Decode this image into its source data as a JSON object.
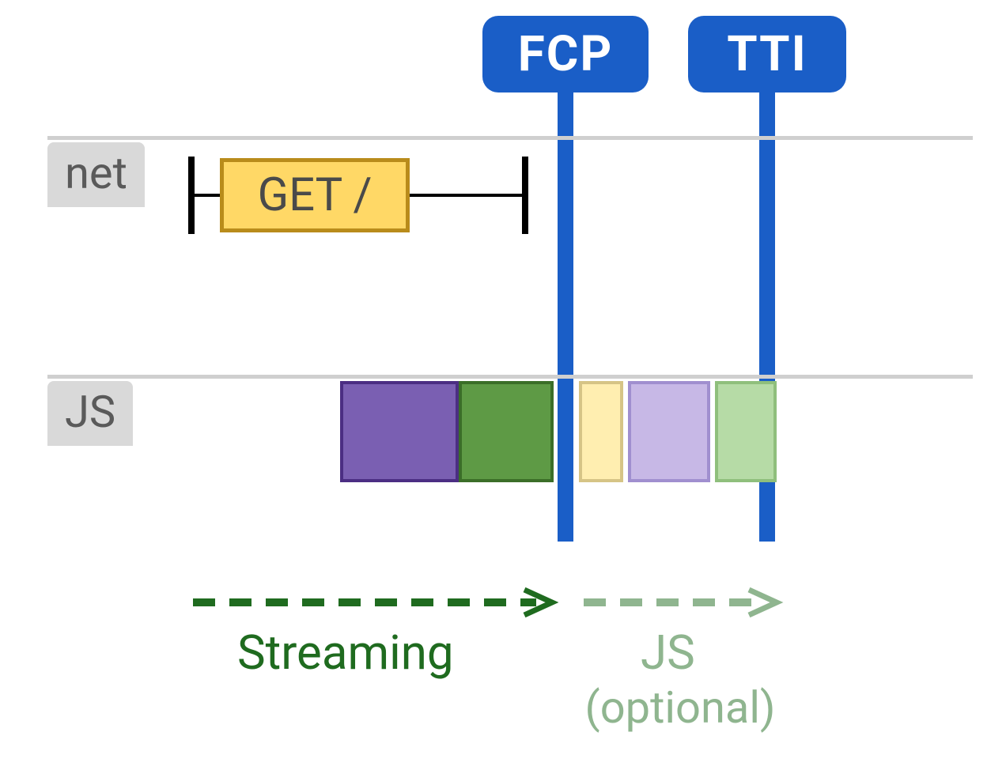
{
  "badges": {
    "fcp": "FCP",
    "tti": "TTI"
  },
  "lanes": {
    "net": "net",
    "js": "JS"
  },
  "net_request": "GET /",
  "arrows": {
    "streaming": "Streaming",
    "js_label": "JS",
    "js_optional": "(optional)"
  },
  "colors": {
    "badge": "#1a5ec7",
    "lane_line": "#cfcfcf",
    "lane_label_bg": "#d9d9d9",
    "lane_label_fg": "#5a5a5a",
    "net_box_bg": "#ffd866",
    "net_box_border": "#b98c1b",
    "purple_fill": "#7a5fb2",
    "purple_border": "#4b2e83",
    "green_fill": "#5e9a45",
    "green_border": "#3b6e28",
    "yellow_light_fill": "#ffeeb0",
    "yellow_light_border": "#d6c486",
    "purple_light_fill": "#c7b8e6",
    "purple_light_border": "#a08fcf",
    "green_light_fill": "#b6dba6",
    "green_light_border": "#8fbf7c",
    "streaming_arrow": "#1f6b1f",
    "streaming_text": "#1f6b1f",
    "js_arrow": "#8fb58f",
    "js_text": "#8fb58f"
  },
  "chart_data": {
    "type": "timeline",
    "title": "Web rendering timeline — Static SSR / Streaming",
    "timeline_range": [
      0,
      1000
    ],
    "markers": [
      {
        "name": "FCP",
        "position": 560
      },
      {
        "name": "TTI",
        "position": 828
      }
    ],
    "lanes": [
      {
        "name": "net",
        "items": [
          {
            "label": "GET /",
            "start": 150,
            "end": 510,
            "box_start": 180,
            "box_end": 400
          }
        ]
      },
      {
        "name": "JS",
        "items": [
          {
            "color": "purple",
            "start": 330,
            "end": 450,
            "opacity": 1.0
          },
          {
            "color": "green",
            "start": 450,
            "end": 548,
            "opacity": 1.0
          },
          {
            "color": "yellow",
            "start": 582,
            "end": 626,
            "opacity": 0.5
          },
          {
            "color": "purple",
            "start": 632,
            "end": 734,
            "opacity": 0.5
          },
          {
            "color": "green",
            "start": 740,
            "end": 818,
            "opacity": 0.5
          }
        ]
      }
    ],
    "phases": [
      {
        "label": "Streaming",
        "start": 150,
        "end": 548,
        "color": "dark-green"
      },
      {
        "label": "JS (optional)",
        "start": 582,
        "end": 818,
        "color": "light-green"
      }
    ]
  }
}
